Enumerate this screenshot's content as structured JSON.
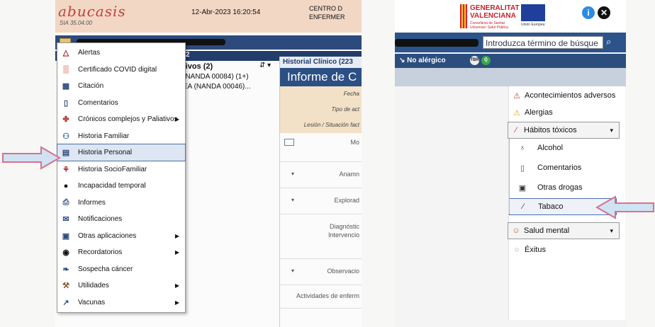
{
  "left": {
    "logo": "abucasis",
    "logo_sub": "SIA 35.04.00",
    "datetime": "12-Abr-2023 16:20:54",
    "center_line1": "CENTRO D",
    "center_line2": "ENFERMER",
    "subbar_text": "2",
    "bg_list_header": "tivos (2)",
    "bg_list_rows": [
      "(NANDA 00084) (1+)",
      "EA (NANDA 00046)..."
    ],
    "sort_icon": "⇵ ▾",
    "right_col": {
      "header": "Historial Clínico (223",
      "title": "Informe de C",
      "sub": [
        "Fecha",
        "Tipo de act",
        "Lesión / Situación fact"
      ],
      "sections": [
        "Mo",
        "Anamn",
        "Explorad",
        "Diagnóstic",
        "Intervencio",
        "Observacio",
        "Actividades de enferm"
      ]
    },
    "menu": [
      {
        "label": "Alertas",
        "icon": "△",
        "icon_name": "warning-triangle-icon",
        "arrow": false
      },
      {
        "label": "Certificado COVID digital",
        "icon": "▒",
        "icon_name": "qr-code-icon",
        "arrow": false
      },
      {
        "label": "Citación",
        "icon": "▦",
        "icon_name": "calendar-icon",
        "arrow": false
      },
      {
        "label": "Comentarios",
        "icon": "▯",
        "icon_name": "comment-icon",
        "arrow": false
      },
      {
        "label": "Crónicos complejos y Paliativos",
        "icon": "✤",
        "icon_name": "chronic-care-icon",
        "arrow": true
      },
      {
        "label": "Historia Familiar",
        "icon": "⚇",
        "icon_name": "family-icon",
        "arrow": false
      },
      {
        "label": "Historia Personal",
        "icon": "▤",
        "icon_name": "personal-history-icon",
        "arrow": false
      },
      {
        "label": "Historia SocioFamiliar",
        "icon": "⚘",
        "icon_name": "social-family-icon",
        "arrow": false
      },
      {
        "label": "Incapacidad temporal",
        "icon": "●",
        "icon_name": "temporary-disability-icon",
        "arrow": false
      },
      {
        "label": "Informes",
        "icon": "⎙",
        "icon_name": "printer-icon",
        "arrow": false
      },
      {
        "label": "Notificaciones",
        "icon": "✉",
        "icon_name": "envelope-icon",
        "arrow": false
      },
      {
        "label": "Otras aplicaciones",
        "icon": "▣",
        "icon_name": "other-apps-icon",
        "arrow": true
      },
      {
        "label": "Recordatorios",
        "icon": "◉",
        "icon_name": "reminder-icon",
        "arrow": true
      },
      {
        "label": "Sospecha cáncer",
        "icon": "❧",
        "icon_name": "cancer-suspicion-icon",
        "arrow": false
      },
      {
        "label": "Utilidades",
        "icon": "⚒",
        "icon_name": "tools-icon",
        "arrow": true
      },
      {
        "label": "Vacunas",
        "icon": "↗",
        "icon_name": "syringe-icon",
        "arrow": true
      }
    ],
    "menu_arrow_glyph": "▶"
  },
  "right": {
    "gva_line1": "GENERALITAT",
    "gva_line2": "VALENCIANA",
    "gva_small": "Conselleria de Sanitat Universal i Salut Pública",
    "eu_text": "Unión Europea",
    "info_glyph": "i",
    "close_glyph": "✕",
    "search_placeholder": "Introduzca término de búsque",
    "search_glyph": "⌕",
    "no_alergico": "No alérgico",
    "badge1": "TBR",
    "badge2": "Q",
    "list": [
      {
        "label": "Acontecimientos adversos",
        "icon": "⚠",
        "icon_name": "adverse-events-icon",
        "kind": "item"
      },
      {
        "label": "Alergias",
        "icon": "⚠",
        "icon_name": "allergy-warning-icon",
        "kind": "item"
      },
      {
        "label": "Hábitos tóxicos",
        "icon": "∕",
        "icon_name": "toxic-habits-icon",
        "kind": "group"
      },
      {
        "label": "Alcohol",
        "icon": "♁",
        "icon_name": "alcohol-glass-icon",
        "kind": "sub"
      },
      {
        "label": "Comentarios",
        "icon": "▯",
        "icon_name": "comment-icon",
        "kind": "sub"
      },
      {
        "label": "Otras drogas",
        "icon": "▣",
        "icon_name": "other-drugs-icon",
        "kind": "sub"
      },
      {
        "label": "Tabaco",
        "icon": "∕",
        "icon_name": "cigarette-icon",
        "kind": "sub-selected"
      },
      {
        "label": "Salud mental",
        "icon": "☺",
        "icon_name": "mental-health-icon",
        "kind": "group"
      },
      {
        "label": "Éxitus",
        "icon": "○",
        "icon_name": "exitus-icon",
        "kind": "item"
      }
    ],
    "chevron_glyph": "▾"
  },
  "colors": {
    "header_peach": "#f2d7c5",
    "nav_blue": "#2c4f84",
    "arrow_fill": "#cfe3f3",
    "arrow_outline": "#d9708f"
  }
}
